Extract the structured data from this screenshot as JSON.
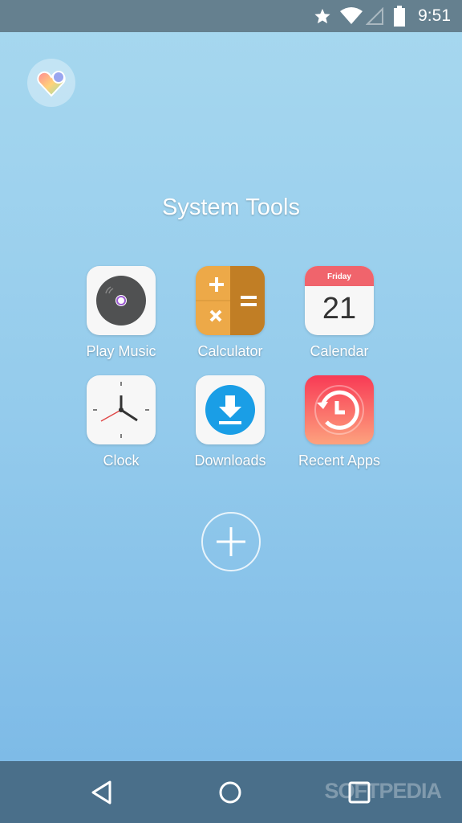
{
  "status_bar": {
    "time": "9:51",
    "icons": [
      "star-icon",
      "wifi-icon",
      "signal-icon",
      "battery-icon"
    ]
  },
  "folder": {
    "title": "System Tools"
  },
  "apps": [
    {
      "label": "Play Music",
      "icon": "disc-icon"
    },
    {
      "label": "Calculator",
      "icon": "calculator-icon"
    },
    {
      "label": "Calendar",
      "icon": "calendar-icon",
      "day": "Friday",
      "date": "21"
    },
    {
      "label": "Clock",
      "icon": "clock-icon"
    },
    {
      "label": "Downloads",
      "icon": "download-icon"
    },
    {
      "label": "Recent Apps",
      "icon": "history-icon"
    }
  ],
  "nav": {
    "watermark": "SOFTPEDIA"
  },
  "colors": {
    "status_bar": "#65808f",
    "nav_bar": "#4a6f8a",
    "calendar_header": "#f0646c",
    "download_blue": "#1a9ee6"
  }
}
